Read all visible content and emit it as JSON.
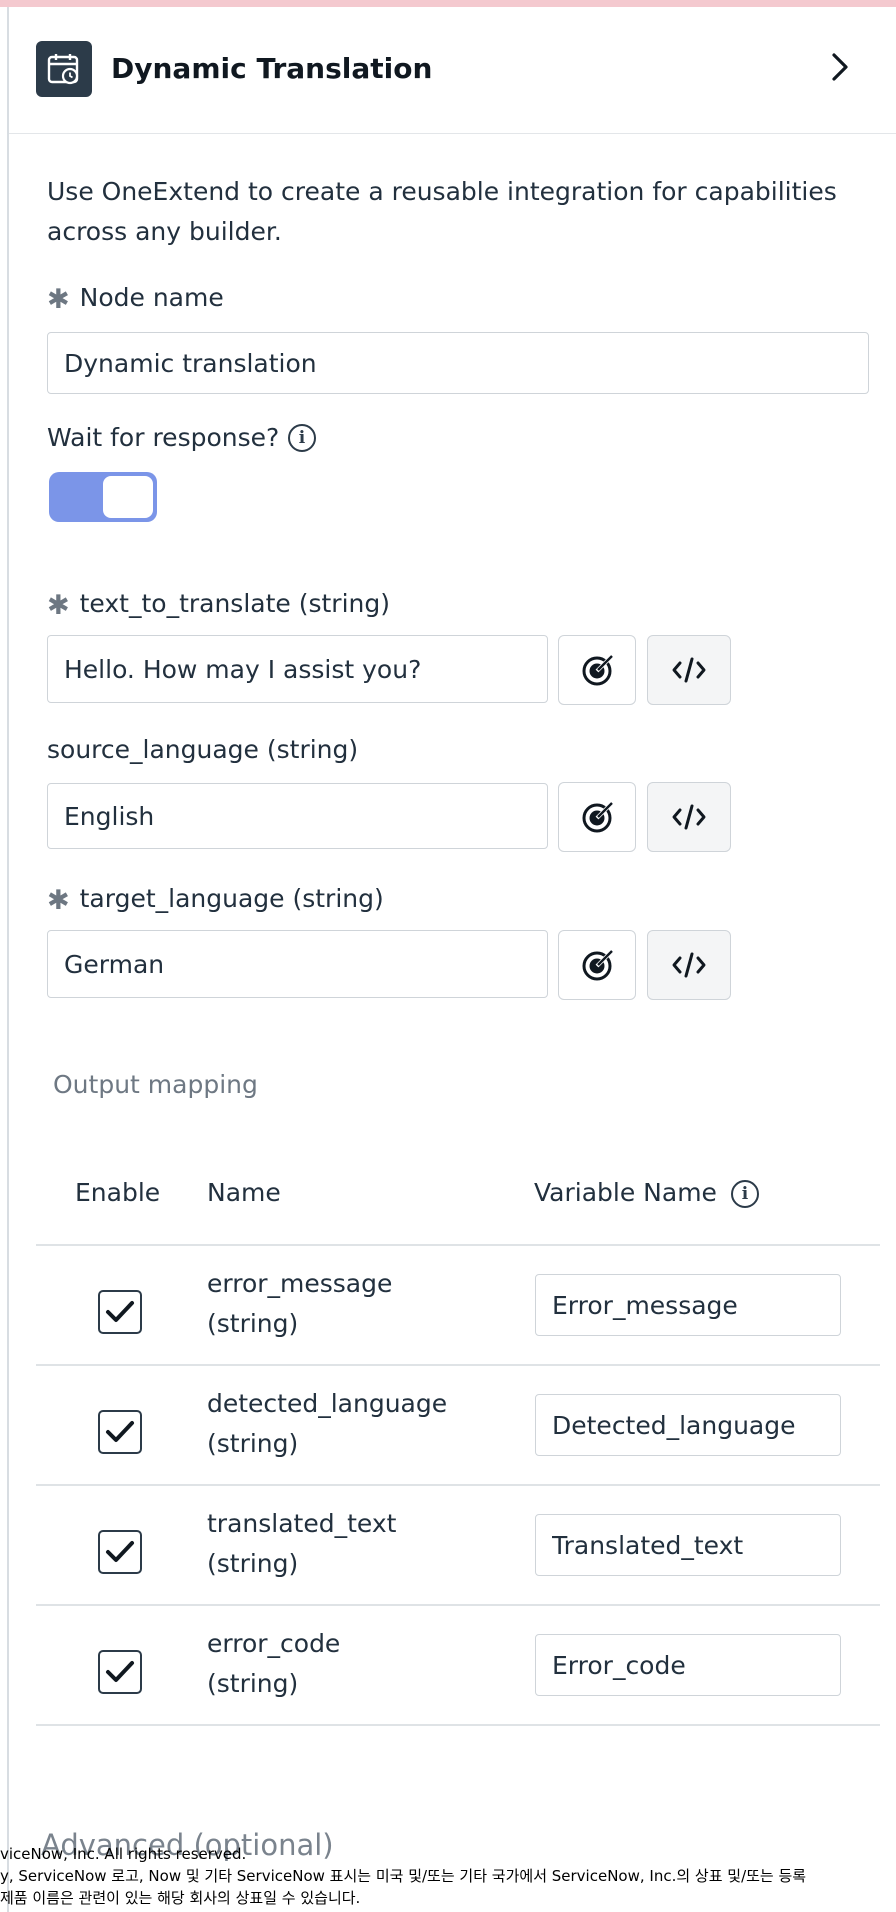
{
  "header": {
    "title": "Dynamic Translation",
    "icon": "calendar-clock-icon",
    "chevron": "chevron-right-icon"
  },
  "description": "Use OneExtend to create a reusable integration for capabilities across any builder.",
  "node_name": {
    "label": "Node name",
    "value": "Dynamic translation"
  },
  "wait_for_response": {
    "label": "Wait for response?",
    "enabled": true
  },
  "inputs": [
    {
      "label": "text_to_translate  (string)",
      "required": true,
      "value": "Hello. How may I assist you?"
    },
    {
      "label": "source_language  (string)",
      "required": false,
      "value": "English"
    },
    {
      "label": "target_language  (string)",
      "required": true,
      "value": "German"
    }
  ],
  "output_mapping": {
    "title": "Output mapping",
    "columns": {
      "enable": "Enable",
      "name": "Name",
      "variable_name": "Variable Name"
    },
    "rows": [
      {
        "name": "error_message",
        "type": "(string)",
        "checked": true,
        "variable": "Error_message"
      },
      {
        "name": "detected_language",
        "type": "(string)",
        "checked": true,
        "variable": "Detected_language"
      },
      {
        "name": "translated_text",
        "type": "(string)",
        "checked": true,
        "variable": "Translated_text"
      },
      {
        "name": "error_code",
        "type": "(string)",
        "checked": true,
        "variable": "Error_code"
      }
    ]
  },
  "advanced": "Advanced (optional)",
  "footer": {
    "line1": "viceNow, Inc. All rights reserved.",
    "line2": "y, ServiceNow 로고, Now 및 기타 ServiceNow 표시는 미국 및/또는 기타 국가에서 ServiceNow, Inc.의 상표 및/또는 등록",
    "line3": " 제품 이름은 관련이 있는 해당 회사의 상표일 수 있습니다."
  },
  "colors": {
    "toggle_on": "#7b95e8",
    "header_icon_bg": "#2c3b49",
    "top_strip": "#f4c9cf"
  }
}
